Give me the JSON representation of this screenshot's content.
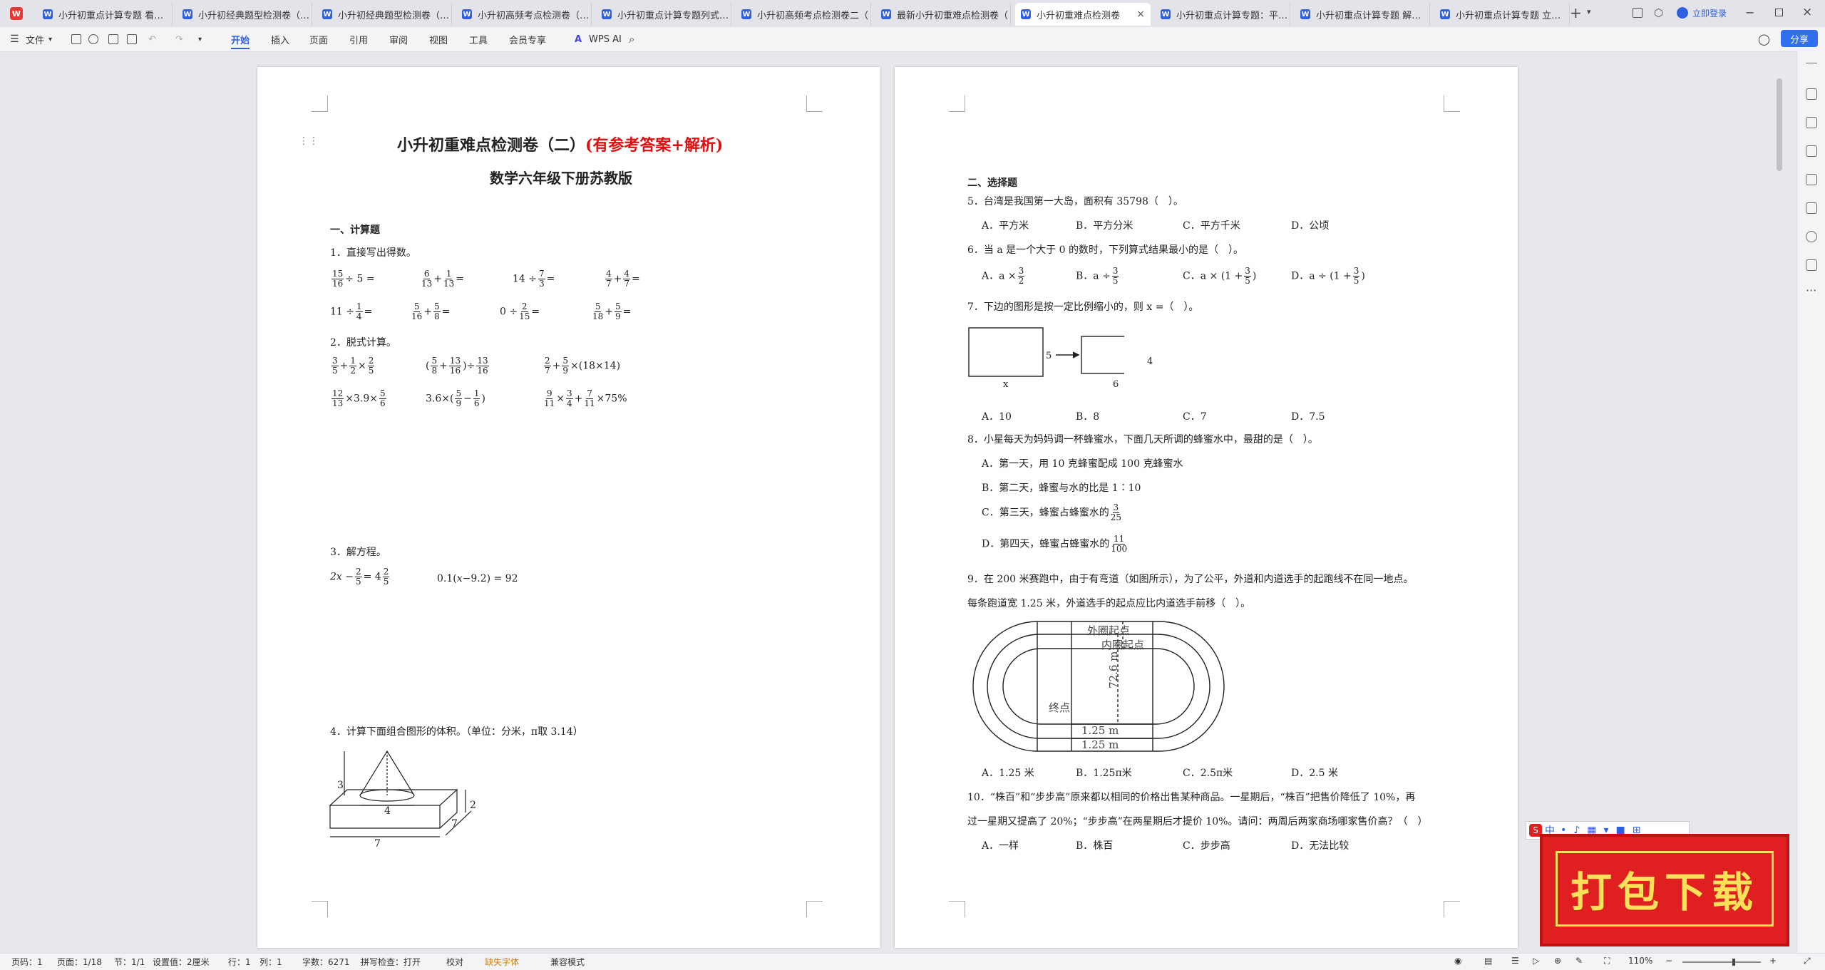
{
  "tabs": [
    "小升初重点计算专题 看图列",
    "小升初经典题型检测卷（一）",
    "小升初经典题型检测卷（二）",
    "小升初高频考点检测卷（一）",
    "小升初重点计算专题列式计算",
    "小升初高频考点检测卷二（",
    "最新小升初重难点检测卷（",
    "小升初重难点检测卷",
    "小升初重点计算专题：平面图",
    "小升初重点计算专题 解方程",
    "小升初重点计算专题 立体图"
  ],
  "login": "立即登录",
  "menu": {
    "file": "文件",
    "items": [
      "开始",
      "插入",
      "页面",
      "引用",
      "审阅",
      "视图",
      "工具",
      "会员专享"
    ],
    "wps_ai": "WPS AI",
    "share": "分享"
  },
  "page1": {
    "title_black": "小升初重难点检测卷（二）",
    "title_red": "(有参考答案+解析)",
    "subtitle": "数学六年级下册苏教版",
    "sec1": "一、计算题",
    "q1": "1．直接写出得数。",
    "q1_row1": [
      "15/16 ÷ 5 =",
      "6/13 + 1/13 =",
      "14 ÷ 7/3 =",
      "4/7 + 4/7 ="
    ],
    "q1_row2": [
      "11 ÷ 1/4 =",
      "5/16 + 5/8 =",
      "0 ÷ 2/15 =",
      "5/18 + 5/9 ="
    ],
    "q2": "2．脱式计算。",
    "q2_row1": [
      "3/5 + 1/2 × 2/5",
      "(5/8 + 13/16) ÷ 13/16",
      "2/7 + 5/9 × (18×14)"
    ],
    "q2_row2": [
      "12/13 × 3.9 × 5/6",
      "3.6 × (5/9 − 1/6)",
      "9/11 × 3/4 + 7/11 × 75%"
    ],
    "q3": "3．解方程。",
    "q3_eq": [
      "2x − 2/5 = 4 2/5",
      "0.1(x − 9.2) = 92"
    ],
    "q4": "4．计算下面组合图形的体积。（单位：分米，π取 3.14）",
    "q4_dims": [
      "3",
      "2",
      "4",
      "7",
      "7"
    ]
  },
  "page2": {
    "sec2": "二、选择题",
    "q5": "5．台湾是我国第一大岛，面积有 35798（　）。",
    "q5_opts": [
      "A．平方米",
      "B．平方分米",
      "C．平方千米",
      "D．公顷"
    ],
    "q6": "6．当 a 是一个大于 0 的数时，下列算式结果最小的是（　）。",
    "q6_opts": [
      "A．a × 3/2",
      "B．a ÷ 3/5",
      "C．a × (1 + 3/5)",
      "D．a ÷ (1 + 3/5)"
    ],
    "q7": "7．下边的图形是按一定比例缩小的，则 x =（　）。",
    "q7_labels": [
      "5",
      "x",
      "4",
      "6"
    ],
    "q7_opts": [
      "A．10",
      "B．8",
      "C．7",
      "D．7.5"
    ],
    "q8": "8．小星每天为妈妈调一杯蜂蜜水，下面几天所调的蜂蜜水中，最甜的是（　）。",
    "q8_opts": [
      "A．第一天，用 10 克蜂蜜配成 100 克蜂蜜水",
      "B．第二天，蜂蜜与水的比是 1∶10",
      "C．第三天，蜂蜜占蜂蜜水的 3/25",
      "D．第四天，蜂蜜占蜂蜜水的 11/100"
    ],
    "q9a": "9．在 200 米赛跑中，由于有弯道（如图所示），为了公平，外道和内道选手的起跑线不在同一地点。",
    "q9b": "每条跑道宽 1.25 米，外道选手的起点应比内道选手前移（　）。",
    "q9_labels": [
      "外圈起点",
      "内圈起点",
      "终点",
      "72.6 m",
      "1.25 m",
      "1.25 m"
    ],
    "q9_opts": [
      "A．1.25 米",
      "B．1.25π米",
      "C．2.5π米",
      "D．2.5 米"
    ],
    "q10a": "10．“株百”和“步步高”原来都以相同的价格出售某种商品。一星期后，“株百”把售价降低了 10%，再",
    "q10b": "过一星期又提高了 20%；“步步高”在两星期后才提价 10%。请问：两周后两家商场哪家售价高？（　）",
    "q10_opts": [
      "A．一样",
      "B．株百",
      "C．步步高",
      "D．无法比较"
    ]
  },
  "ime": "中",
  "promo": "打包下载",
  "status": [
    "页码：1",
    "页面：1/18",
    "节：1/1",
    "设置值：2厘米",
    "行：1",
    "列：1",
    "字数：6271",
    "拼写检查：打开",
    "校对",
    "缺失字体",
    "兼容模式"
  ],
  "zoom": "110%",
  "colors": {
    "accent": "#2f5fe0",
    "title_red": "#e01010",
    "promo_red": "#e02020",
    "promo_gold": "#fbe05a"
  }
}
